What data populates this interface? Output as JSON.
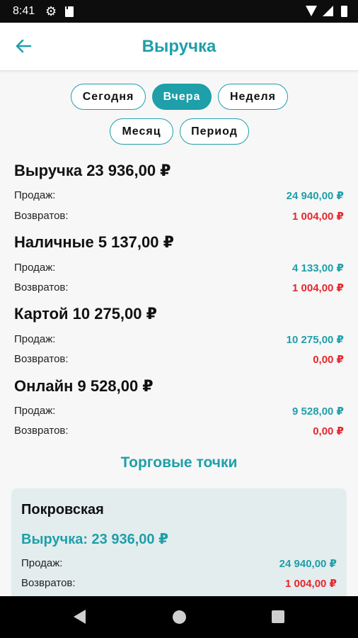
{
  "status_bar": {
    "time": "8:41"
  },
  "app_bar": {
    "title": "Выручка"
  },
  "period_tabs": [
    {
      "label": "Сегодня",
      "active": false
    },
    {
      "label": "Вчера",
      "active": true
    },
    {
      "label": "Неделя",
      "active": false
    },
    {
      "label": "Месяц",
      "active": false
    },
    {
      "label": "Период",
      "active": false
    }
  ],
  "summary": [
    {
      "title": "Выручка 23 936,00 ₽",
      "sales_label": "Продаж:",
      "sales": "24 940,00 ₽",
      "returns_label": "Возвратов:",
      "returns": "1 004,00 ₽"
    },
    {
      "title": "Наличные 5 137,00 ₽",
      "sales_label": "Продаж:",
      "sales": "4 133,00 ₽",
      "returns_label": "Возвратов:",
      "returns": "1 004,00 ₽"
    },
    {
      "title": "Картой 10 275,00 ₽",
      "sales_label": "Продаж:",
      "sales": "10 275,00 ₽",
      "returns_label": "Возвратов:",
      "returns": "0,00 ₽"
    },
    {
      "title": "Онлайн 9 528,00 ₽",
      "sales_label": "Продаж:",
      "sales": "9 528,00 ₽",
      "returns_label": "Возвратов:",
      "returns": "0,00 ₽"
    }
  ],
  "points_title": "Торговые точки",
  "points": [
    {
      "name": "Покровская",
      "revenue": "Выручка: 23 936,00 ₽",
      "sales_label": "Продаж:",
      "sales": "24 940,00 ₽",
      "returns_label": "Возвратов:",
      "returns": "1 004,00 ₽"
    }
  ],
  "colors": {
    "accent": "#1e9fa9",
    "negative": "#e6262b",
    "card_bg": "#e3edee"
  }
}
